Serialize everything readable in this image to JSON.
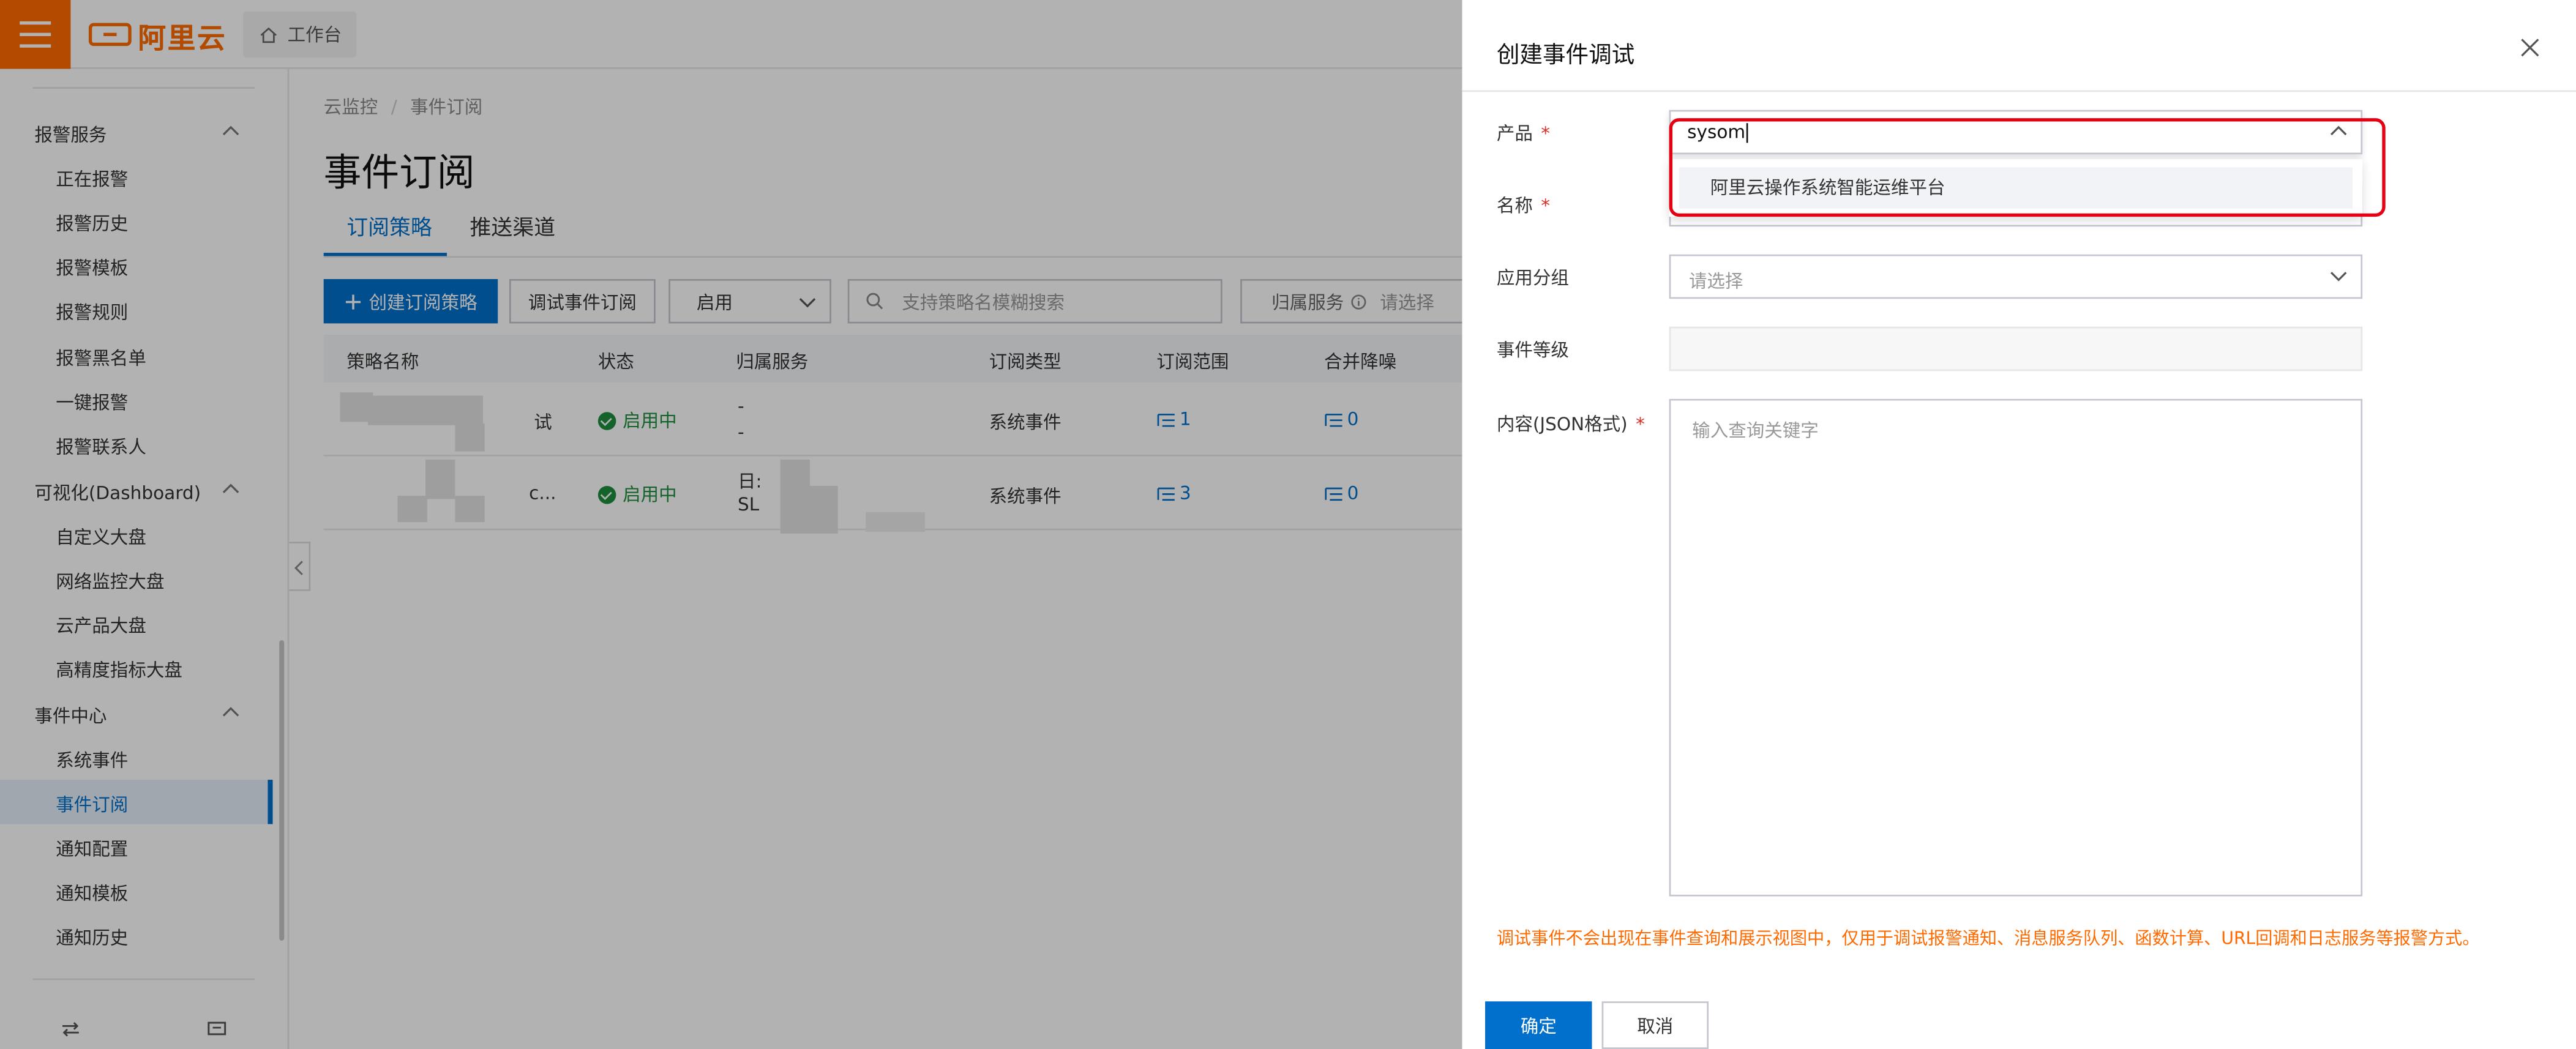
{
  "brand": {
    "logo_text": "阿里云",
    "workspace_label": "工作台",
    "accent": "#ff6a00",
    "primary": "#0070cc"
  },
  "sidebar": {
    "groups": [
      {
        "label": "报警服务",
        "items": [
          "正在报警",
          "报警历史",
          "报警模板",
          "报警规则",
          "报警黑名单",
          "一键报警",
          "报警联系人"
        ]
      },
      {
        "label": "可视化(Dashboard)",
        "items": [
          "自定义大盘",
          "网络监控大盘",
          "云产品大盘",
          "高精度指标大盘"
        ]
      },
      {
        "label": "事件中心",
        "items": [
          "系统事件",
          "事件订阅",
          "通知配置",
          "通知模板",
          "通知历史"
        ]
      }
    ],
    "active_item": "事件订阅"
  },
  "main": {
    "breadcrumb": [
      "云监控",
      "事件订阅"
    ],
    "title": "事件订阅",
    "tabs": [
      "订阅策略",
      "推送渠道"
    ],
    "active_tab": "订阅策略",
    "toolbar": {
      "create_label": "创建订阅策略",
      "debug_label": "调试事件订阅",
      "status_select": "启用",
      "search_placeholder": "支持策略名模糊搜索",
      "filter_label": "归属服务",
      "filter_placeholder": "请选择"
    },
    "table": {
      "columns": [
        "策略名称",
        "状态",
        "归属服务",
        "订阅类型",
        "订阅范围",
        "合并降噪"
      ],
      "rows": [
        {
          "name": "试",
          "status": "启用中",
          "service_line1": "-",
          "service_line2": "-",
          "type": "系统事件",
          "scope": "1",
          "noise": "0"
        },
        {
          "name": "c...",
          "status": "启用中",
          "service_line1": "日:",
          "service_line2": "SL",
          "type": "系统事件",
          "scope": "3",
          "noise": "0"
        }
      ]
    }
  },
  "drawer": {
    "title": "创建事件调试",
    "product_label": "产品",
    "product_value": "sysom",
    "product_option": "阿里云操作系统智能运维平台",
    "name_label": "名称",
    "group_label": "应用分组",
    "group_placeholder": "请选择",
    "level_label": "事件等级",
    "content_label": "内容(JSON格式)",
    "content_placeholder": "输入查询关键字",
    "required_mark": "*",
    "notice": "调试事件不会出现在事件查询和展示视图中，仅用于调试报警通知、消息服务队列、函数计算、URL回调和日志服务等报警方式。",
    "ok_label": "确定",
    "cancel_label": "取消"
  }
}
